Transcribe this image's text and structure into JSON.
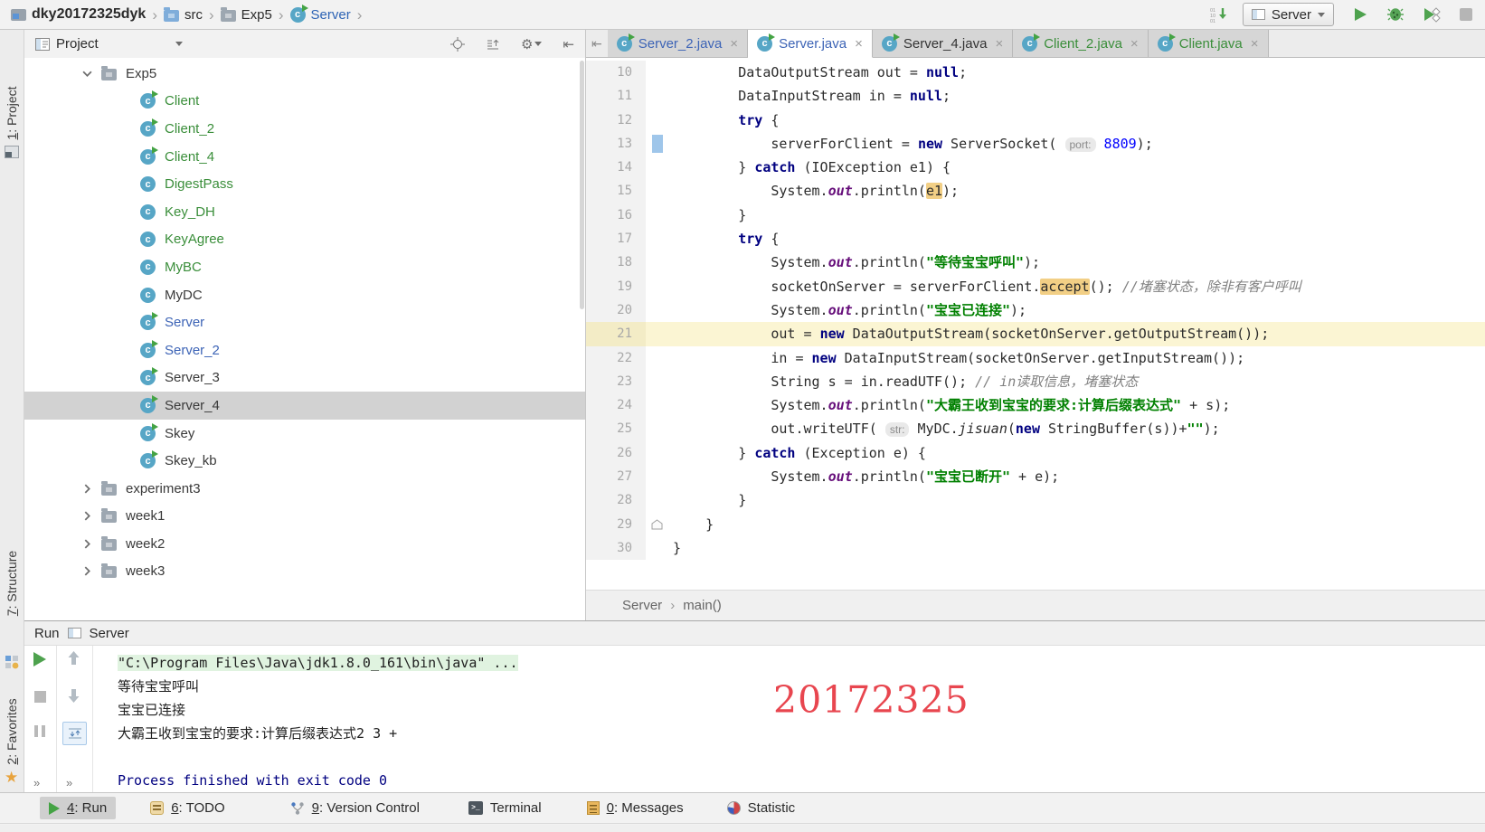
{
  "topbar": {
    "breadcrumbs": [
      {
        "label": "dky20172325dyk",
        "icon": "project",
        "style": "bold"
      },
      {
        "label": "src",
        "icon": "folder-blue",
        "style": ""
      },
      {
        "label": "Exp5",
        "icon": "folder",
        "style": ""
      },
      {
        "label": "Server",
        "icon": "class-run",
        "style": "blue"
      }
    ],
    "run_config": "Server"
  },
  "left_stripe": {
    "items": [
      {
        "num": "1",
        "label": "Project"
      },
      {
        "num": "7",
        "label": "Structure"
      },
      {
        "num": "2",
        "label": "Favorites"
      }
    ]
  },
  "project_panel": {
    "title": "Project",
    "tree": [
      {
        "label": "Exp5",
        "type": "folder",
        "expanded": true,
        "level": 0,
        "color": "k"
      },
      {
        "label": "Client",
        "type": "class",
        "run": true,
        "level": 1,
        "color": "g"
      },
      {
        "label": "Client_2",
        "type": "class",
        "run": true,
        "level": 1,
        "color": "g"
      },
      {
        "label": "Client_4",
        "type": "class",
        "run": true,
        "level": 1,
        "color": "g"
      },
      {
        "label": "DigestPass",
        "type": "class",
        "run": false,
        "level": 1,
        "color": "g"
      },
      {
        "label": "Key_DH",
        "type": "class",
        "run": false,
        "level": 1,
        "color": "g"
      },
      {
        "label": "KeyAgree",
        "type": "class",
        "run": false,
        "level": 1,
        "color": "g"
      },
      {
        "label": "MyBC",
        "type": "class",
        "run": false,
        "level": 1,
        "color": "g"
      },
      {
        "label": "MyDC",
        "type": "class",
        "run": false,
        "level": 1,
        "color": "k"
      },
      {
        "label": "Server",
        "type": "class",
        "run": true,
        "level": 1,
        "color": "b"
      },
      {
        "label": "Server_2",
        "type": "class",
        "run": true,
        "level": 1,
        "color": "b"
      },
      {
        "label": "Server_3",
        "type": "class",
        "run": true,
        "level": 1,
        "color": "k"
      },
      {
        "label": "Server_4",
        "type": "class",
        "run": true,
        "level": 1,
        "color": "k",
        "selected": true
      },
      {
        "label": "Skey",
        "type": "class",
        "run": true,
        "level": 1,
        "color": "k"
      },
      {
        "label": "Skey_kb",
        "type": "class",
        "run": true,
        "level": 1,
        "color": "k"
      },
      {
        "label": "experiment3",
        "type": "folder",
        "expanded": false,
        "level": 0,
        "color": "k"
      },
      {
        "label": "week1",
        "type": "folder",
        "expanded": false,
        "level": 0,
        "color": "k"
      },
      {
        "label": "week2",
        "type": "folder",
        "expanded": false,
        "level": 0,
        "color": "k"
      },
      {
        "label": "week3",
        "type": "folder",
        "expanded": false,
        "level": 0,
        "color": "k"
      }
    ]
  },
  "editor": {
    "tabs": [
      {
        "label": "Server_2.java",
        "color": "tblue",
        "active": false
      },
      {
        "label": "Server.java",
        "color": "tblue",
        "active": true
      },
      {
        "label": "Server_4.java",
        "color": "tblack",
        "active": false
      },
      {
        "label": "Client_2.java",
        "color": "tgreen",
        "active": false
      },
      {
        "label": "Client.java",
        "color": "tgreen",
        "active": false
      }
    ],
    "breadcrumb": {
      "class": "Server",
      "method": "main()"
    },
    "code": {
      "lines": [
        {
          "n": "10",
          "t": [
            [
              "p",
              "        DataOutputStream out = "
            ],
            [
              "k",
              "null"
            ],
            [
              "p",
              ";"
            ]
          ]
        },
        {
          "n": "11",
          "t": [
            [
              "p",
              "        DataInputStream in = "
            ],
            [
              "k",
              "null"
            ],
            [
              "p",
              ";"
            ]
          ]
        },
        {
          "n": "12",
          "t": [
            [
              "p",
              "        "
            ],
            [
              "k",
              "try"
            ],
            [
              "p",
              " {"
            ]
          ]
        },
        {
          "n": "13",
          "mark": true,
          "t": [
            [
              "p",
              "            serverForClient = "
            ],
            [
              "k",
              "new"
            ],
            [
              "p",
              " ServerSocket( "
            ],
            [
              "hint",
              "port:"
            ],
            [
              "p",
              " "
            ],
            [
              "n",
              "8809"
            ],
            [
              "p",
              ");"
            ]
          ]
        },
        {
          "n": "14",
          "t": [
            [
              "p",
              "        } "
            ],
            [
              "k",
              "catch"
            ],
            [
              "p",
              " (IOException e1) {"
            ]
          ]
        },
        {
          "n": "15",
          "t": [
            [
              "p",
              "            System."
            ],
            [
              "f",
              "out"
            ],
            [
              "p",
              ".println("
            ],
            [
              "hl",
              "e1"
            ],
            [
              "p",
              ");"
            ]
          ]
        },
        {
          "n": "16",
          "t": [
            [
              "p",
              "        }"
            ]
          ]
        },
        {
          "n": "17",
          "t": [
            [
              "p",
              "        "
            ],
            [
              "k",
              "try"
            ],
            [
              "p",
              " {"
            ]
          ]
        },
        {
          "n": "18",
          "t": [
            [
              "p",
              "            System."
            ],
            [
              "f",
              "out"
            ],
            [
              "p",
              ".println("
            ],
            [
              "s",
              "\"等待宝宝呼叫\""
            ],
            [
              "p",
              ");"
            ]
          ]
        },
        {
          "n": "19",
          "t": [
            [
              "p",
              "            socketOnServer = serverForClient."
            ],
            [
              "hl",
              "accept"
            ],
            [
              "p",
              "(); "
            ],
            [
              "c",
              "//堵塞状态，除非有客户呼叫"
            ]
          ]
        },
        {
          "n": "20",
          "t": [
            [
              "p",
              "            System."
            ],
            [
              "f",
              "out"
            ],
            [
              "p",
              ".println("
            ],
            [
              "s",
              "\"宝宝已连接\""
            ],
            [
              "p",
              ");"
            ]
          ]
        },
        {
          "n": "21",
          "cur": true,
          "t": [
            [
              "p",
              "            out = "
            ],
            [
              "k",
              "new"
            ],
            [
              "p",
              " DataOutputStream(socketOnServer.getOutputStream());"
            ]
          ]
        },
        {
          "n": "22",
          "t": [
            [
              "p",
              "            in = "
            ],
            [
              "k",
              "new"
            ],
            [
              "p",
              " DataInputStream(socketOnServer.getInputStream());"
            ]
          ]
        },
        {
          "n": "23",
          "t": [
            [
              "p",
              "            String s = in.readUTF(); "
            ],
            [
              "c",
              "// in读取信息，堵塞状态"
            ]
          ]
        },
        {
          "n": "24",
          "t": [
            [
              "p",
              "            System."
            ],
            [
              "f",
              "out"
            ],
            [
              "p",
              ".println("
            ],
            [
              "s",
              "\"大霸王收到宝宝的要求:计算后缀表达式\""
            ],
            [
              "p",
              " + s);"
            ]
          ]
        },
        {
          "n": "25",
          "t": [
            [
              "p",
              "            out.writeUTF( "
            ],
            [
              "hint",
              "str:"
            ],
            [
              "p",
              " MyDC."
            ],
            [
              "m",
              "jisuan"
            ],
            [
              "p",
              "("
            ],
            [
              "k",
              "new"
            ],
            [
              "p",
              " StringBuffer(s))+"
            ],
            [
              "s",
              "\"\""
            ],
            [
              "p",
              ");"
            ]
          ]
        },
        {
          "n": "26",
          "t": [
            [
              "p",
              "        } "
            ],
            [
              "k",
              "catch"
            ],
            [
              "p",
              " (Exception e) {"
            ]
          ]
        },
        {
          "n": "27",
          "t": [
            [
              "p",
              "            System."
            ],
            [
              "f",
              "out"
            ],
            [
              "p",
              ".println("
            ],
            [
              "s",
              "\"宝宝已断开\""
            ],
            [
              "p",
              " + e);"
            ]
          ]
        },
        {
          "n": "28",
          "t": [
            [
              "p",
              "        }"
            ]
          ]
        },
        {
          "n": "29",
          "fold": true,
          "t": [
            [
              "p",
              "    }"
            ]
          ]
        },
        {
          "n": "30",
          "t": [
            [
              "p",
              "}"
            ]
          ]
        }
      ]
    }
  },
  "run_panel": {
    "tab": "Run",
    "session": "Server",
    "console": [
      {
        "style": "cmd",
        "text": "\"C:\\Program Files\\Java\\jdk1.8.0_161\\bin\\java\" ..."
      },
      {
        "style": "plain",
        "text": "等待宝宝呼叫"
      },
      {
        "style": "plain",
        "text": "宝宝已连接"
      },
      {
        "style": "plain",
        "text": "大霸王收到宝宝的要求:计算后缀表达式2 3 +"
      },
      {
        "style": "blank",
        "text": ""
      },
      {
        "style": "sys",
        "text": "Process finished with exit code 0"
      }
    ],
    "watermark": "20172325"
  },
  "status_bar": {
    "items": [
      {
        "num": "4",
        "label": "Run",
        "icon": "run",
        "active": true
      },
      {
        "num": "6",
        "label": "TODO",
        "icon": "todo",
        "active": false
      },
      {
        "num": "9",
        "label": "Version Control",
        "icon": "vcs",
        "active": false
      },
      {
        "num": null,
        "label": "Terminal",
        "icon": "terminal",
        "active": false
      },
      {
        "num": "0",
        "label": "Messages",
        "icon": "messages",
        "active": false
      },
      {
        "num": null,
        "label": "Statistic",
        "icon": "statistic",
        "active": false
      }
    ]
  }
}
